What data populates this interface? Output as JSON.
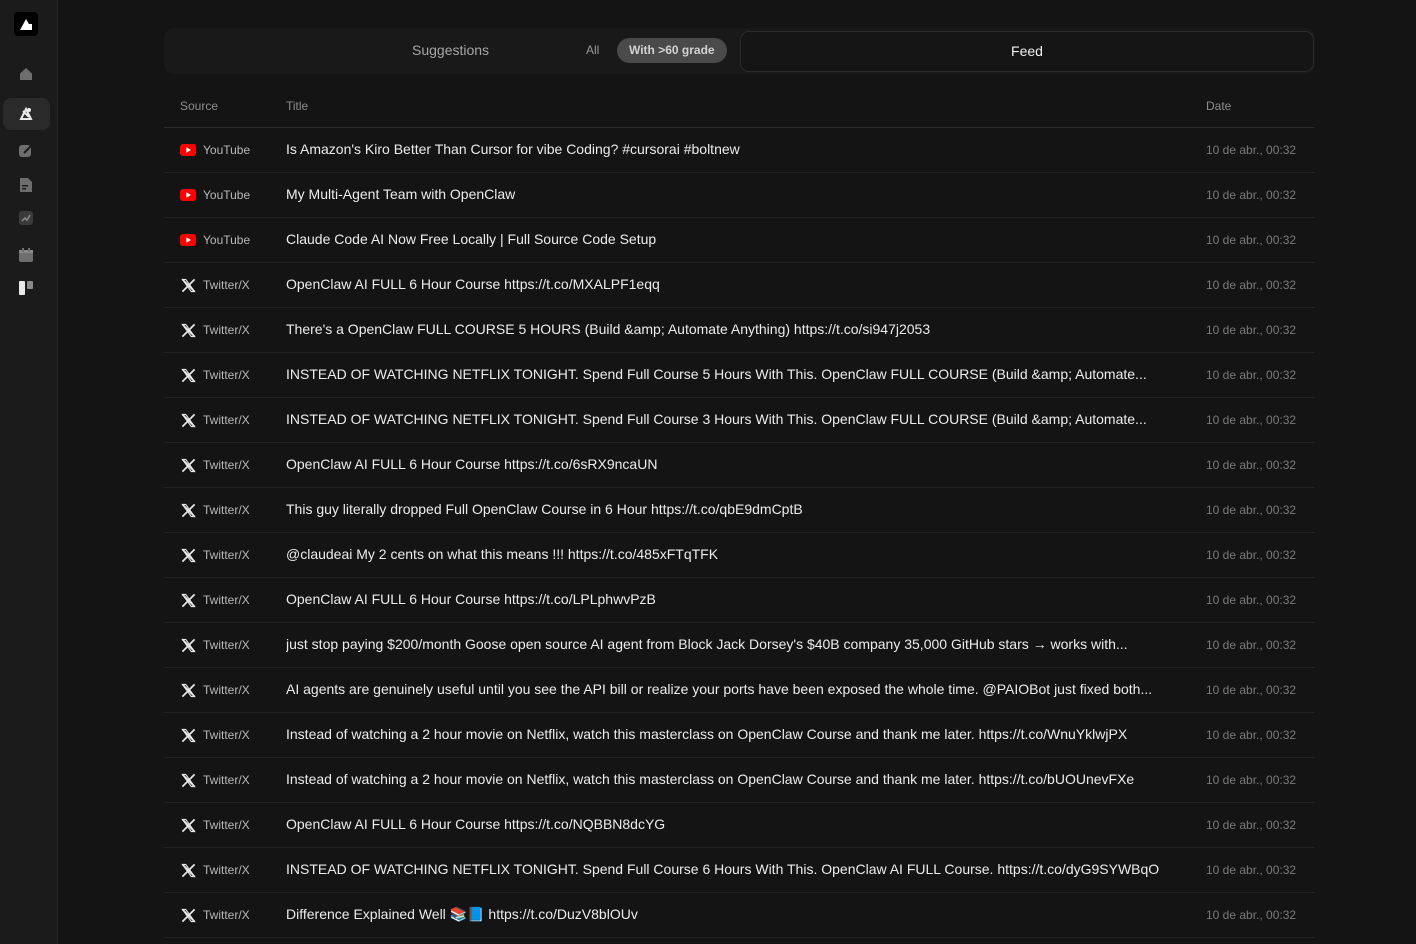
{
  "sidebar": {
    "logo_icon": "app-logo-icon",
    "items": [
      {
        "icon": "home-icon",
        "active": false
      },
      {
        "icon": "compass-icon",
        "active": true
      },
      {
        "icon": "edit-icon",
        "active": false
      },
      {
        "icon": "document-icon",
        "active": false
      },
      {
        "icon": "chart-icon",
        "active": false
      },
      {
        "icon": "calendar-icon",
        "active": false
      },
      {
        "icon": "board-icon",
        "active": false
      }
    ]
  },
  "tabs": {
    "suggestions": "Suggestions",
    "all": "All",
    "grade": "With >60 grade",
    "feed": "Feed"
  },
  "table": {
    "headers": {
      "source": "Source",
      "title": "Title",
      "date": "Date"
    },
    "rows": [
      {
        "source": "YouTube",
        "icon": "youtube-icon",
        "title": "Is Amazon's Kiro Better Than Cursor for vibe Coding? #cursorai #boltnew",
        "date": "10 de abr., 00:32"
      },
      {
        "source": "YouTube",
        "icon": "youtube-icon",
        "title": "My Multi-Agent Team with OpenClaw",
        "date": "10 de abr., 00:32"
      },
      {
        "source": "YouTube",
        "icon": "youtube-icon",
        "title": "Claude Code AI Now Free Locally | Full Source Code Setup",
        "date": "10 de abr., 00:32"
      },
      {
        "source": "Twitter/X",
        "icon": "x-icon",
        "title": "OpenClaw AI FULL 6 Hour Course https://t.co/MXALPF1eqq",
        "date": "10 de abr., 00:32"
      },
      {
        "source": "Twitter/X",
        "icon": "x-icon",
        "title": "There's a OpenClaw FULL COURSE 5 HOURS (Build &amp; Automate Anything) https://t.co/si947j2053",
        "date": "10 de abr., 00:32"
      },
      {
        "source": "Twitter/X",
        "icon": "x-icon",
        "title": "INSTEAD OF WATCHING NETFLIX TONIGHT. Spend Full Course 5 Hours With This. OpenClaw FULL COURSE (Build &amp; Automate...",
        "date": "10 de abr., 00:32"
      },
      {
        "source": "Twitter/X",
        "icon": "x-icon",
        "title": "INSTEAD OF WATCHING NETFLIX TONIGHT. Spend Full Course 3 Hours With This. OpenClaw FULL COURSE (Build &amp; Automate...",
        "date": "10 de abr., 00:32"
      },
      {
        "source": "Twitter/X",
        "icon": "x-icon",
        "title": "OpenClaw AI FULL 6 Hour Course https://t.co/6sRX9ncaUN",
        "date": "10 de abr., 00:32"
      },
      {
        "source": "Twitter/X",
        "icon": "x-icon",
        "title": "This guy literally dropped Full OpenClaw Course in 6 Hour https://t.co/qbE9dmCptB",
        "date": "10 de abr., 00:32"
      },
      {
        "source": "Twitter/X",
        "icon": "x-icon",
        "title": "@claudeai My 2 cents on what this means !!! https://t.co/485xFTqTFK",
        "date": "10 de abr., 00:32"
      },
      {
        "source": "Twitter/X",
        "icon": "x-icon",
        "title": "OpenClaw AI FULL 6 Hour Course https://t.co/LPLphwvPzB",
        "date": "10 de abr., 00:32"
      },
      {
        "source": "Twitter/X",
        "icon": "x-icon",
        "title": "just stop paying $200/month Goose open source AI agent from Block Jack Dorsey's $40B company 35,000 GitHub stars → works with...",
        "date": "10 de abr., 00:32"
      },
      {
        "source": "Twitter/X",
        "icon": "x-icon",
        "title": "AI agents are genuinely useful until you see the API bill or realize your ports have been exposed the whole time. @PAIOBot just fixed both...",
        "date": "10 de abr., 00:32"
      },
      {
        "source": "Twitter/X",
        "icon": "x-icon",
        "title": "Instead of watching a 2 hour movie on Netflix, watch this masterclass on OpenClaw Course and thank me later. https://t.co/WnuYklwjPX",
        "date": "10 de abr., 00:32"
      },
      {
        "source": "Twitter/X",
        "icon": "x-icon",
        "title": "Instead of watching a 2 hour movie on Netflix, watch this masterclass on OpenClaw Course and thank me later. https://t.co/bUOUnevFXe",
        "date": "10 de abr., 00:32"
      },
      {
        "source": "Twitter/X",
        "icon": "x-icon",
        "title": "OpenClaw AI FULL 6 Hour Course https://t.co/NQBBN8dcYG",
        "date": "10 de abr., 00:32"
      },
      {
        "source": "Twitter/X",
        "icon": "x-icon",
        "title": "INSTEAD OF WATCHING NETFLIX TONIGHT. Spend Full Course 6 Hours With This. OpenClaw AI FULL Course. https://t.co/dyG9SYWBqO",
        "date": "10 de abr., 00:32"
      },
      {
        "source": "Twitter/X",
        "icon": "x-icon",
        "title": "Difference Explained Well 📚📘 https://t.co/DuzV8blOUv",
        "date": "10 de abr., 00:32"
      }
    ]
  },
  "colors": {
    "youtube": "#ff0000",
    "background": "#141414"
  }
}
